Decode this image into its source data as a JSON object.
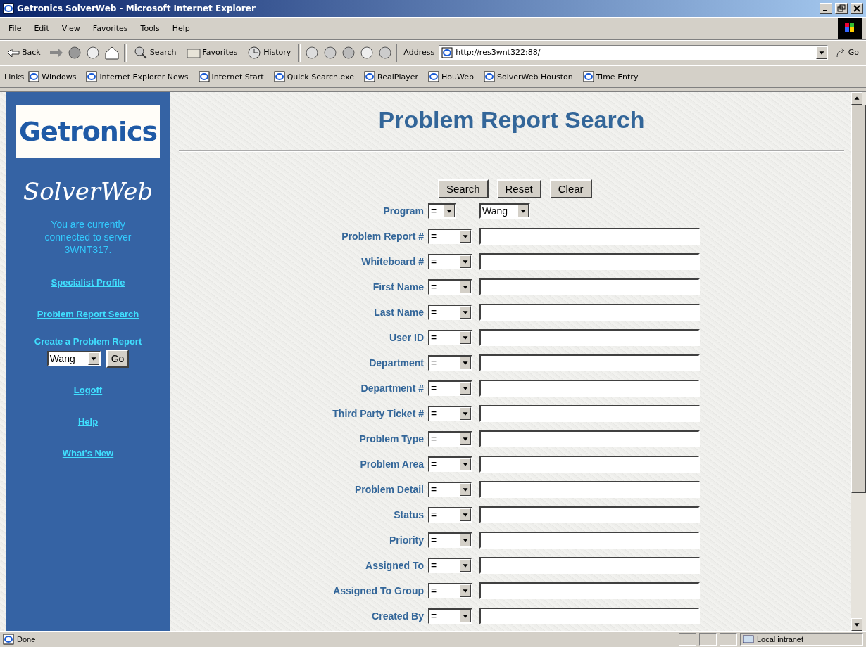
{
  "window": {
    "title": "Getronics SolverWeb - Microsoft Internet Explorer"
  },
  "menu": [
    "File",
    "Edit",
    "View",
    "Favorites",
    "Tools",
    "Help"
  ],
  "toolbar": {
    "back": "Back",
    "search": "Search",
    "favorites": "Favorites",
    "history": "History",
    "address_label": "Address",
    "address": "http://res3wnt322:88/",
    "go": "Go"
  },
  "links_bar": {
    "label": "Links",
    "items": [
      "Windows",
      "Internet Explorer News",
      "Internet Start",
      "Quick Search.exe",
      "RealPlayer",
      "HouWeb",
      "SolverWeb Houston",
      "Time Entry"
    ]
  },
  "sidebar": {
    "logo": "Getronics",
    "app_name": "SolverWeb",
    "server_note": "You are currently connected to server 3WNT317.",
    "links_top": [
      "Specialist Profile",
      "Problem Report Search"
    ],
    "create_label": "Create a Problem Report",
    "create_program": "Wang",
    "go": "Go",
    "links_bottom": [
      "Logoff",
      "Help",
      "What's New"
    ]
  },
  "page": {
    "title": "Problem Report Search",
    "buttons": [
      "Search",
      "Reset",
      "Clear"
    ],
    "fields": [
      {
        "label": "Program",
        "operator": "=",
        "kind": "select",
        "value": "Wang"
      },
      {
        "label": "Problem Report #",
        "operator": "=",
        "kind": "text"
      },
      {
        "label": "Whiteboard #",
        "operator": "=",
        "kind": "text"
      },
      {
        "label": "First Name",
        "operator": "=",
        "kind": "text"
      },
      {
        "label": "Last Name",
        "operator": "=",
        "kind": "text"
      },
      {
        "label": "User ID",
        "operator": "=",
        "kind": "text"
      },
      {
        "label": "Department",
        "operator": "=",
        "kind": "text"
      },
      {
        "label": "Department #",
        "operator": "=",
        "kind": "text"
      },
      {
        "label": "Third Party Ticket #",
        "operator": "=",
        "kind": "text"
      },
      {
        "label": "Problem Type",
        "operator": "=",
        "kind": "text"
      },
      {
        "label": "Problem Area",
        "operator": "=",
        "kind": "text"
      },
      {
        "label": "Problem Detail",
        "operator": "=",
        "kind": "text"
      },
      {
        "label": "Status",
        "operator": "=",
        "kind": "text"
      },
      {
        "label": "Priority",
        "operator": "=",
        "kind": "text"
      },
      {
        "label": "Assigned To",
        "operator": "=",
        "kind": "text"
      },
      {
        "label": "Assigned To Group",
        "operator": "=",
        "kind": "text"
      },
      {
        "label": "Created By",
        "operator": "=",
        "kind": "text"
      }
    ]
  },
  "status_bar": {
    "text": "Done",
    "zone": "Local intranet"
  }
}
